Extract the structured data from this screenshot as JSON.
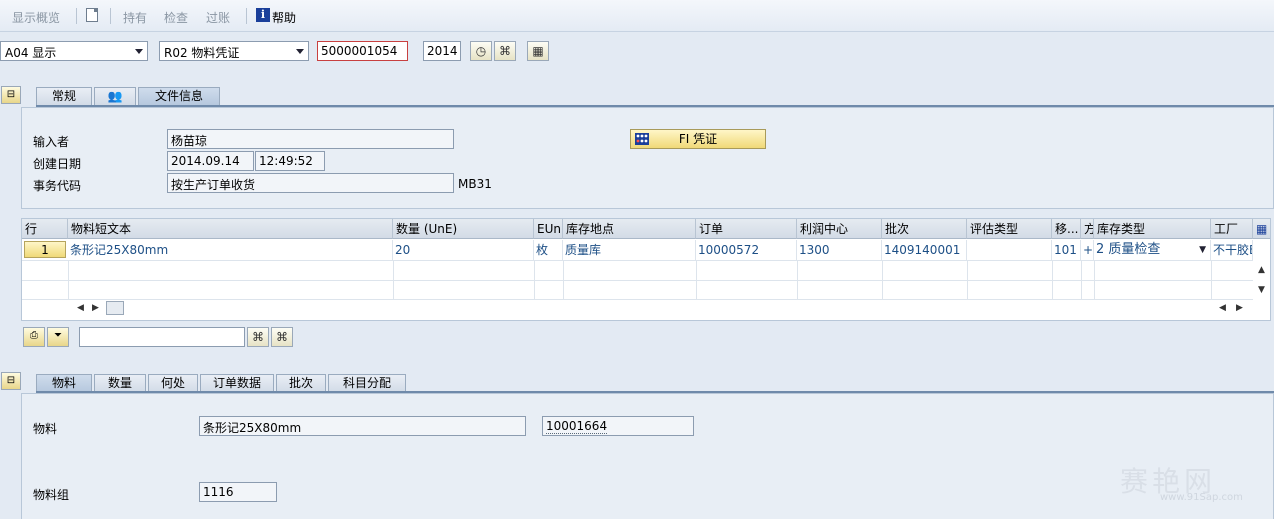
{
  "toolbar": {
    "overview": "显示概览",
    "hold": "持有",
    "check": "检查",
    "post": "过账",
    "help": "帮助"
  },
  "header": {
    "action_select": "A04 显示",
    "doc_type_select": "R02 物料凭证",
    "doc_number": "5000001054",
    "year": "2014"
  },
  "tabs_top": [
    {
      "label": "常规"
    },
    {
      "label": ""
    },
    {
      "label": "文件信息",
      "active": true
    }
  ],
  "doc_info": {
    "entered_by_label": "输入者",
    "entered_by": "杨苗琼",
    "created_label": "创建日期",
    "created_date": "2014.09.14",
    "created_time": "12:49:52",
    "trans_label": "事务代码",
    "trans_text": "按生产订单收货",
    "trans_code": "MB31",
    "fi_button": "FI 凭证"
  },
  "table": {
    "headers": [
      "行",
      "物料短文本",
      "数量 (UnE)",
      "EUn",
      "库存地点",
      "订单",
      "利润中心",
      "批次",
      "评估类型",
      "移...",
      "方",
      "库存类型",
      "工厂"
    ],
    "row": {
      "line": "1",
      "material_text": "条形记25X80mm",
      "qty": "20",
      "unit": "枚",
      "storage": "质量库",
      "order": "10000572",
      "profit_center": "1300",
      "batch": "1409140001",
      "valuation": "",
      "movement": "101",
      "direction": "+",
      "stock_type": "2 质量检查",
      "plant": "不干胶E"
    }
  },
  "tabs_bottom": [
    {
      "label": "物料",
      "active": true
    },
    {
      "label": "数量"
    },
    {
      "label": "何处"
    },
    {
      "label": "订单数据"
    },
    {
      "label": "批次"
    },
    {
      "label": "科目分配"
    }
  ],
  "material": {
    "material_label": "物料",
    "material_text": "条形记25X80mm",
    "material_number": "10001664",
    "group_label": "物料组",
    "group_value": "1116"
  },
  "watermark": {
    "main": "赛艳网",
    "sub": "www.91Sap.com"
  }
}
